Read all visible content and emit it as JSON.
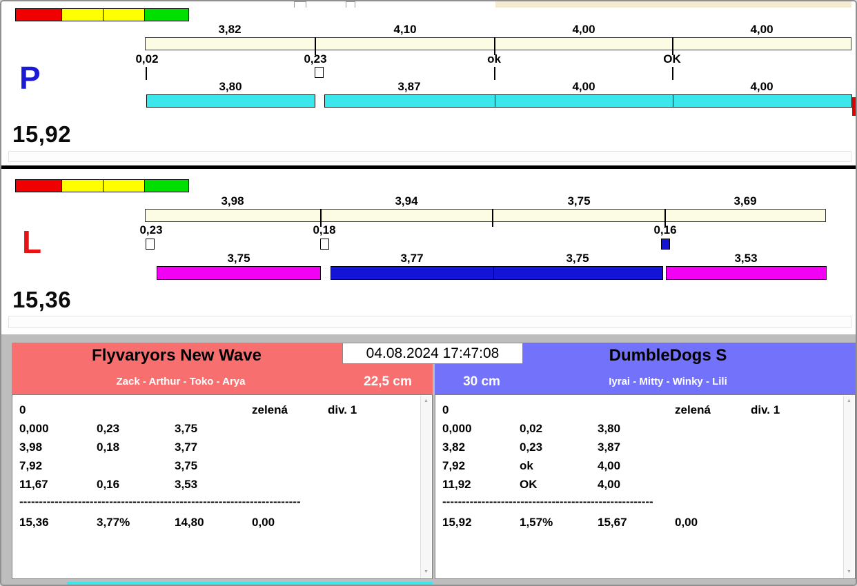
{
  "window": {
    "datetime": "04.08.2024 17:47:08"
  },
  "lanes": {
    "p": {
      "label": "P",
      "total": "15,92",
      "top_splits": [
        "3,82",
        "4,10",
        "4,00",
        "4,00"
      ],
      "checkpoints": [
        "0,02",
        "0,23",
        "ok",
        "OK"
      ],
      "bottom_splits": [
        "3,80",
        "3,87",
        "4,00",
        "4,00"
      ]
    },
    "l": {
      "label": "L",
      "total": "15,36",
      "top_splits": [
        "3,98",
        "3,94",
        "3,75",
        "3,69"
      ],
      "checkpoints": [
        "0,23",
        "0,18",
        "0,16"
      ],
      "bottom_splits": [
        "3,75",
        "3,77",
        "3,75",
        "3,53"
      ]
    }
  },
  "teams": {
    "left": {
      "name": "Flyvaryors New Wave",
      "dogs": "Zack - Arthur - Toko - Arya",
      "jump_height": "22,5 cm",
      "lead": "0",
      "status": "zelená",
      "division": "div. 1",
      "rows": [
        [
          "0,000",
          "0,23",
          "3,75"
        ],
        [
          "3,98",
          "0,18",
          "3,77"
        ],
        [
          "7,92",
          "",
          "3,75"
        ],
        [
          "11,67",
          "0,16",
          "3,53"
        ]
      ],
      "separator": "------------------------------------------------------------------------",
      "totals": [
        "15,36",
        "3,77%",
        "14,80",
        "0,00"
      ]
    },
    "right": {
      "name": "DumbleDogs S",
      "dogs": "Iyrai - Mitty - Winky - Lili",
      "jump_height": "30 cm",
      "lead": "0",
      "status": "zelená",
      "division": "div. 1",
      "rows": [
        [
          "0,000",
          "0,02",
          "3,80"
        ],
        [
          "3,82",
          "0,23",
          "3,87"
        ],
        [
          "7,92",
          "ok",
          "4,00"
        ],
        [
          "11,92",
          "OK",
          "4,00"
        ]
      ],
      "separator": "------------------------------------------------------",
      "totals": [
        "15,92",
        "1,57%",
        "15,67",
        "0,00"
      ]
    }
  },
  "icons": {
    "scroll_up": "▲",
    "scroll_down": "▼"
  },
  "colors": {
    "cyan_bar": "#3be6ec",
    "magenta_bar": "#f202f2",
    "blue_bar": "#1414d6",
    "cream_bar": "#fcfbe4",
    "left_header": "#f86f6f",
    "right_header": "#7372fb",
    "p_letter": "#1b1bd6",
    "l_letter": "#e51515"
  }
}
